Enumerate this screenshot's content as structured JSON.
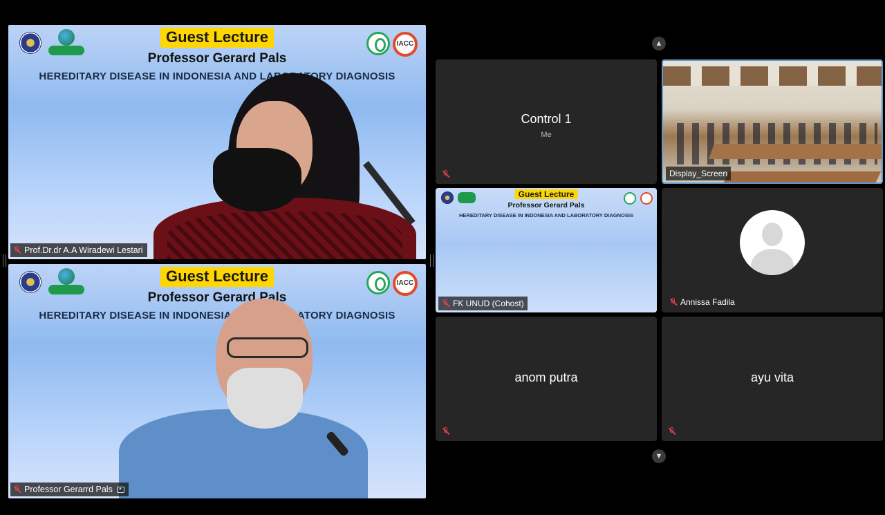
{
  "slide": {
    "banner_title": "Guest Lecture",
    "speaker": "Professor Gerard Pals",
    "topic": "HEREDITARY DISEASE IN INDONESIA AND LABORATORY DIAGNOSIS",
    "logo_right_text": "IACC"
  },
  "big_tiles": [
    {
      "name": "Prof.Dr.dr A.A Wiradewi Lestari",
      "muted": true,
      "sharing": false
    },
    {
      "name": "Professor Gerarrd Pals",
      "muted": true,
      "sharing": true
    }
  ],
  "gallery": {
    "tiles": [
      {
        "name": "Control 1",
        "subtitle": "Me",
        "muted": true
      },
      {
        "name": "Display_Screen",
        "muted": false
      },
      {
        "name": "FK UNUD (Cohost)",
        "muted": true
      },
      {
        "name": "Annissa Fadila",
        "muted": true
      },
      {
        "name": "anom putra",
        "muted": true
      },
      {
        "name": "ayu vita",
        "muted": true
      }
    ]
  },
  "icons": {
    "scroll_up": "▲",
    "scroll_down": "▼"
  },
  "colors": {
    "banner_yellow": "#ffd600",
    "mic_muted": "#e0404e",
    "active_speaker_border": "#5b9bd5",
    "tile_bg": "#262626"
  }
}
